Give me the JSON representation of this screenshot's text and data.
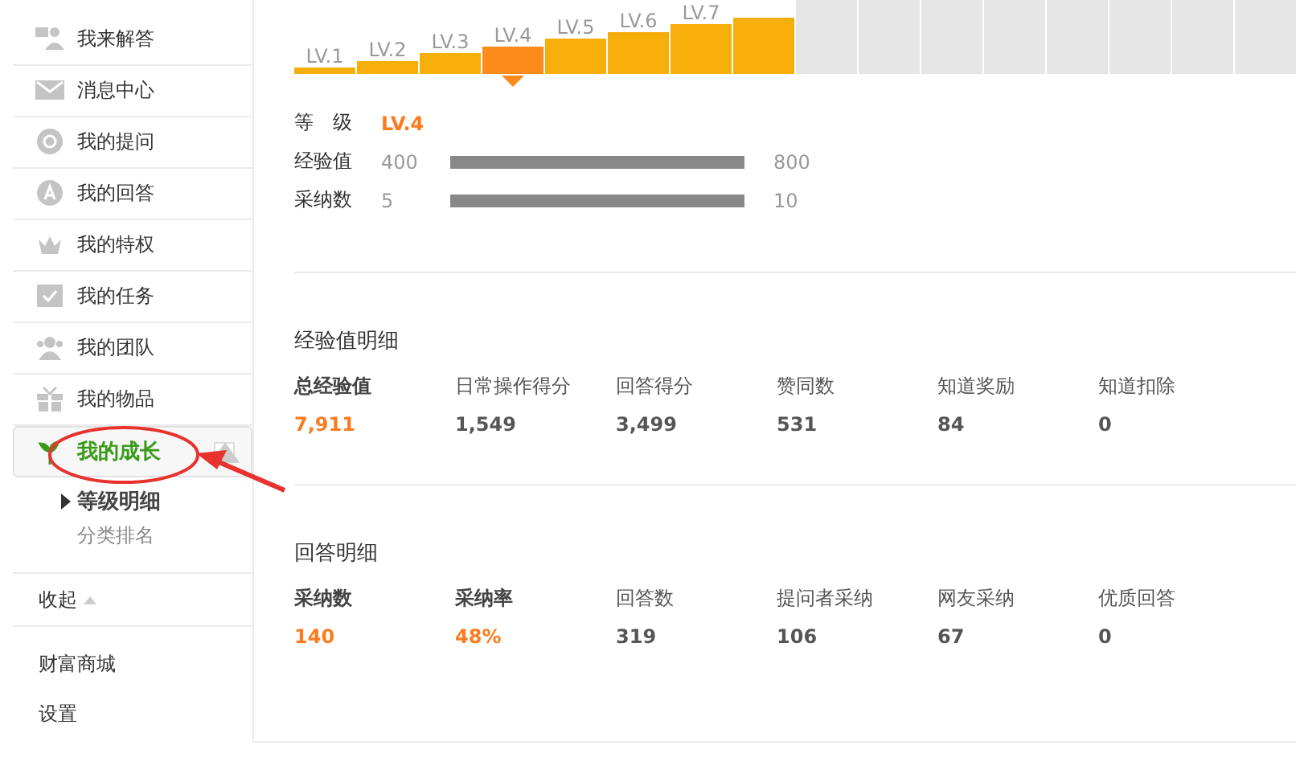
{
  "sidebar": {
    "items": [
      {
        "label": "我来解答",
        "selected": false
      },
      {
        "label": "消息中心",
        "selected": false
      },
      {
        "label": "我的提问",
        "selected": false
      },
      {
        "label": "我的回答",
        "selected": false
      },
      {
        "label": "我的特权",
        "selected": false
      },
      {
        "label": "我的任务",
        "selected": false
      },
      {
        "label": "我的团队",
        "selected": false
      },
      {
        "label": "我的物品",
        "selected": false
      },
      {
        "label": "我的成长",
        "selected": true,
        "expanded": true,
        "children": [
          {
            "label": "等级明细",
            "selected": true
          },
          {
            "label": "分类排名",
            "selected": false
          }
        ]
      }
    ],
    "collapse": {
      "label": "收起"
    },
    "links": [
      {
        "label": "财富商城"
      },
      {
        "label": "设置"
      }
    ]
  },
  "levels": [
    {
      "label": "LV.1",
      "reached": true,
      "selected": false
    },
    {
      "label": "LV.2",
      "reached": true,
      "selected": false
    },
    {
      "label": "LV.3",
      "reached": true,
      "selected": false
    },
    {
      "label": "LV.4",
      "reached": true,
      "selected": true
    },
    {
      "label": "LV.5",
      "reached": true,
      "selected": false
    },
    {
      "label": "LV.6",
      "reached": true,
      "selected": false
    },
    {
      "label": "LV.7",
      "reached": true,
      "selected": false
    },
    {
      "reached": true,
      "selected": false
    },
    {
      "reached": false,
      "selected": false
    },
    {
      "reached": false,
      "selected": false
    },
    {
      "reached": false,
      "selected": false
    },
    {
      "reached": false,
      "selected": false
    },
    {
      "reached": false,
      "selected": false
    },
    {
      "reached": false,
      "selected": false
    },
    {
      "reached": false,
      "selected": false
    },
    {
      "reached": false,
      "selected": false
    }
  ],
  "grade": {
    "label": "等　级",
    "value": "LV.4"
  },
  "progress": [
    {
      "label": "经验值",
      "current": "400",
      "level": 1,
      "target": "800"
    },
    {
      "label": "采纳数",
      "current": "5",
      "level": 1,
      "target": "10"
    }
  ],
  "sections": [
    {
      "title": "经验值明细",
      "stats": [
        {
          "label": "总经验值",
          "value": "7,911",
          "highlight": true
        },
        {
          "label": "日常操作得分",
          "value": "1,549",
          "highlight": false
        },
        {
          "label": "回答得分",
          "value": "3,499",
          "highlight": false
        },
        {
          "label": "赞同数",
          "value": "531",
          "highlight": false
        },
        {
          "label": "知道奖励",
          "value": "84",
          "highlight": false
        },
        {
          "label": "知道扣除",
          "value": "0",
          "highlight": false
        }
      ]
    },
    {
      "title": "回答明细",
      "stats": [
        {
          "label": "采纳数",
          "value": "140",
          "highlight": true
        },
        {
          "label": "采纳率",
          "value": "48%",
          "highlight": true
        },
        {
          "label": "回答数",
          "value": "319",
          "highlight": false
        },
        {
          "label": "提问者采纳",
          "value": "106",
          "highlight": false
        },
        {
          "label": "网友采纳",
          "value": "67",
          "highlight": false
        },
        {
          "label": "优质回答",
          "value": "0",
          "highlight": false
        }
      ]
    }
  ]
}
